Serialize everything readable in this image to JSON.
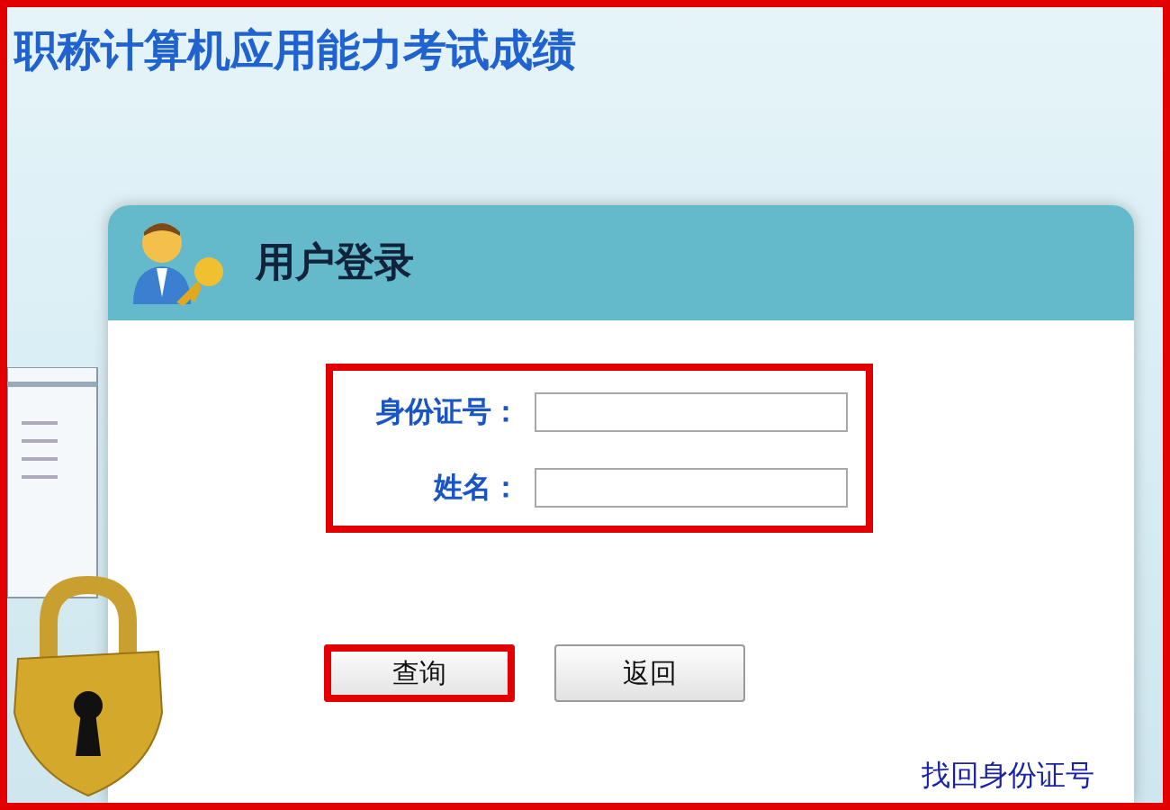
{
  "page": {
    "title": "职称计算机应用能力考试成绩",
    "highlighted": true
  },
  "login": {
    "heading": "用户登录",
    "form": {
      "highlighted": true,
      "fields": [
        {
          "label": "身份证号："
        },
        {
          "label": "姓名："
        }
      ]
    },
    "buttons": [
      {
        "label": "查询",
        "highlighted": true
      },
      {
        "label": "返回",
        "highlighted": false
      }
    ],
    "link": "找回身份证号"
  }
}
